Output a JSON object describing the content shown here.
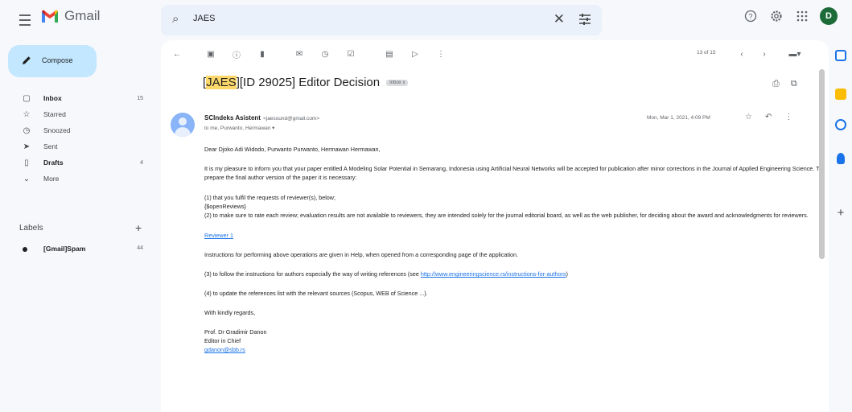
{
  "app": {
    "name": "Gmail"
  },
  "search": {
    "value": "JAES"
  },
  "account": {
    "initial": "D",
    "color": "#1e6b3a"
  },
  "compose": {
    "label": "Compose"
  },
  "nav": [
    {
      "label": "Inbox",
      "count": "15",
      "icon": "inbox-icon",
      "bold": true
    },
    {
      "label": "Starred",
      "count": "",
      "icon": "star-icon",
      "bold": false
    },
    {
      "label": "Snoozed",
      "count": "",
      "icon": "clock-icon",
      "bold": false
    },
    {
      "label": "Sent",
      "count": "",
      "icon": "send-icon",
      "bold": false
    },
    {
      "label": "Drafts",
      "count": "4",
      "icon": "draft-icon",
      "bold": true
    },
    {
      "label": "More",
      "count": "",
      "icon": "chevron-down-icon",
      "bold": false
    }
  ],
  "labels": {
    "heading": "Labels",
    "items": [
      {
        "name": "[Gmail]Spam",
        "count": "44"
      }
    ]
  },
  "toolbar": {
    "pager": "13 of 15"
  },
  "email": {
    "subject_highlight": "JAES",
    "subject_rest": "[ID 29025] Editor Decision",
    "folder_chip": "Inbox x",
    "sender_name": "SCIndeks Asistent",
    "sender_email": "<jaesound@gmail.com>",
    "to_line": "to me, Purwanto, Hermawan ▾",
    "date": "Mon, Mar 1, 2021, 4:09 PM",
    "greeting": "Dear Djoko Adi Widodo, Purwanto Purwanto, Hermawan Hermawan,",
    "intro": "It is my pleasure to inform you that your paper entitled A Modeling Solar Potential in Semarang, Indonesia using Artificial Neural Networks will be accepted for publication after minor corrections in the Journal of Applied Engineering Science. To prepare the final author version of the paper it is necessary:",
    "item1": "(1) that you fulfil the requests of reviewer(s), below;",
    "open_reviews": "{$openReviews}",
    "item2": "(2) to make sure to rate each review; evaluation results are not available to reviewers, they are intended solely for the journal editorial board, as well as the web publisher, for deciding about the award and acknowledgments for reviewers.",
    "reviewer_link": "Reviewer 1",
    "instructions": "Instructions for performing above operations are given in Help, when opened from a corresponding page of the application.",
    "item3_text": "(3) to follow the instructions for authors especially the way of writing references (see ",
    "item3_link": "http://www.engineeringscience.rs/instructions-for-authors",
    "item3_end": ")",
    "item4": "(4) to update the references list  with the relevant sources (Scopus, WEB of Science ...).",
    "regards": "With kindly regards,",
    "signer": "Prof. Dr Gradimir Danon",
    "signer_title": "Editor in Chief",
    "signer_email": "gdanon@sbb.rs"
  }
}
